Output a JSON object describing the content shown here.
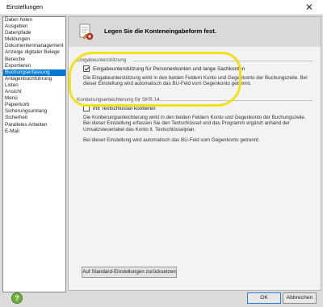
{
  "window": {
    "title": "Einstellungen",
    "close_glyph": "✕"
  },
  "sidebar": {
    "items": [
      {
        "label": "Daten holen"
      },
      {
        "label": "Ausgeben"
      },
      {
        "label": "Datenpfade"
      },
      {
        "label": "Meldungen"
      },
      {
        "label": "Dokumentenmanagement"
      },
      {
        "label": "Anzeige digitaler Belege"
      },
      {
        "label": "Bereiche"
      },
      {
        "label": "Exportieren"
      },
      {
        "label": "Buchungserfassung",
        "selected": true
      },
      {
        "label": "Anlagenbuchführung"
      },
      {
        "label": "Listen"
      },
      {
        "label": "Ansicht"
      },
      {
        "label": "Menü"
      },
      {
        "label": "Papierkorb"
      },
      {
        "label": "Sicherungsumlang"
      },
      {
        "label": "Sicherheit"
      },
      {
        "label": "Paralleles Arbeiten"
      },
      {
        "label": "E-Mail"
      }
    ]
  },
  "main": {
    "header_title": "Legen Sie die Konteneingabeform fest.",
    "header_icon": "document-settings-icon",
    "section1": {
      "label": "Eingabeunterstützung",
      "checkbox_label": "Eingabeunterstützung für Personenkonten und lange Sachkonten",
      "checked": true,
      "paragraph": "Die Eingabeunterstützung wirkt in den beiden Feldern Konto und Gegenkonto der Buchungszeile. Bei dieser Einstellung wird automatisch das BU-Feld vom Gegenkonto getrennt."
    },
    "section2": {
      "label": "Kontierungserleichterung für SKR 14",
      "checkbox_label": "mit Textschlüssel kontieren",
      "checked": false,
      "paragraph1": "Die Kontierungserleichterung wirkt in den beiden Feldern Konto und Gegenkonto der Buchungszeile. Bei dieser Einstellung erfassen Sie den Textschlüssel und das Programm ergänzt anhand der Umsatzsteuerlabel das Konto lt. Textschlüsselplan.",
      "paragraph2": "Bei dieser Einstellung wird automatisch das BU-Feld vom Gegenkonto getrennt."
    },
    "reset_button": "Auf Standard-Einstellungen zurücksetzen"
  },
  "footer": {
    "help_icon": "help-icon",
    "help_glyph": "?",
    "ok_label": "OK",
    "cancel_label": "Abbrechen"
  },
  "colors": {
    "selection": "#0078d7",
    "highlight": "#f2e21a",
    "help": "#6fae3a"
  }
}
